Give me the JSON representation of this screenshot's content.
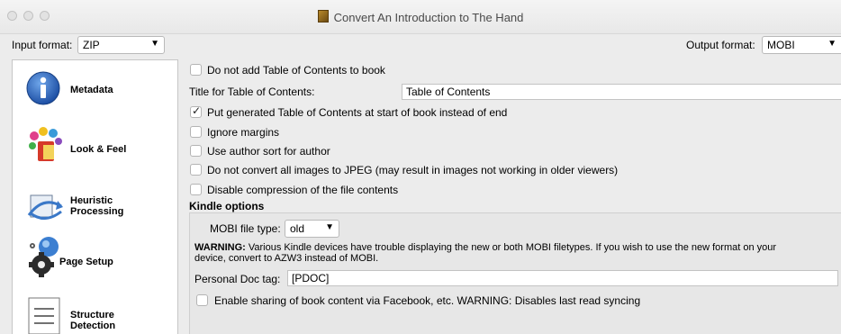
{
  "window": {
    "title": "Convert An Introduction to The Hand"
  },
  "format_row": {
    "input_label": "Input format:",
    "input_value": "ZIP",
    "output_label": "Output format:",
    "output_value": "MOBI"
  },
  "sidebar": {
    "items": [
      {
        "label": "Metadata",
        "icon": "info-icon"
      },
      {
        "label": "Look & Feel",
        "icon": "paint-palette-icon"
      },
      {
        "label_line1": "Heuristic",
        "label_line2": "Processing",
        "icon": "heuristic-arrows-icon"
      },
      {
        "label": "Page Setup",
        "icon": "page-setup-icon"
      },
      {
        "label_line1": "Structure",
        "label_line2": "Detection",
        "icon": "structure-icon"
      }
    ]
  },
  "options": {
    "no_toc": {
      "label": "Do not add Table of Contents to book",
      "checked": false
    },
    "toc_title_label": "Title for Table of Contents:",
    "toc_title_value": "Table of Contents",
    "toc_at_start": {
      "label": "Put generated Table of Contents at start of book instead of end",
      "checked": true
    },
    "ignore_margins": {
      "label": "Ignore margins",
      "checked": false
    },
    "author_sort": {
      "label": "Use author sort for author",
      "checked": false
    },
    "no_jpeg": {
      "label": "Do not convert all images to JPEG (may result in images not working in older viewers)",
      "checked": false
    },
    "no_compress": {
      "label": "Disable compression of the file contents",
      "checked": false
    }
  },
  "kindle": {
    "heading": "Kindle options",
    "filetype_label": "MOBI file type:",
    "filetype_value": "old",
    "warning_bold": "WARNING:",
    "warning_line1": " Various Kindle devices have trouble displaying the new or both MOBI filetypes. If you wish to use the new format on your",
    "warning_line2": "device, convert to AZW3 instead of MOBI.",
    "doc_tag_label": "Personal Doc tag:",
    "doc_tag_value": "[PDOC]",
    "share": {
      "label": "Enable sharing of book content via Facebook, etc. WARNING: Disables last read syncing",
      "checked": false
    }
  }
}
